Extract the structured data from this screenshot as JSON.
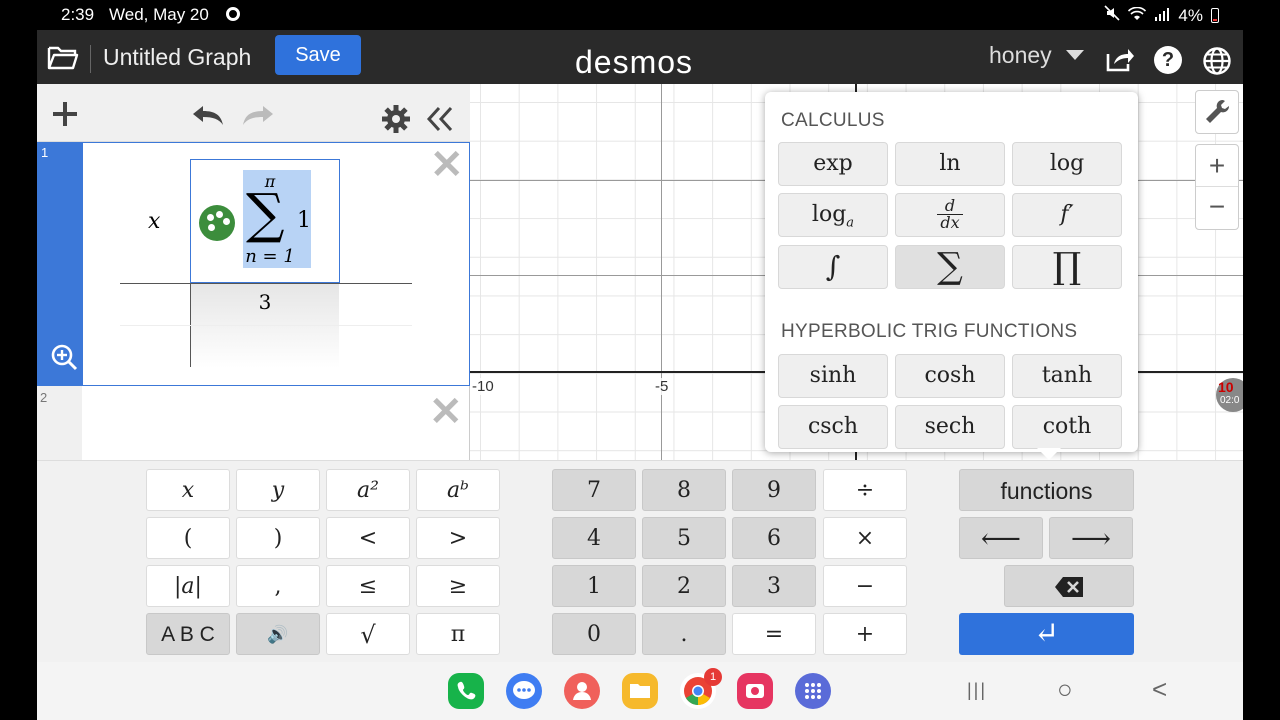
{
  "status_bar": {
    "time": "2:39",
    "date": "Wed, May 20",
    "battery": "4%"
  },
  "header": {
    "title": "Untitled Graph",
    "save_label": "Save",
    "logo": "desmos",
    "user": "honey"
  },
  "expressions": [
    {
      "index": "1",
      "table": {
        "header_x": "x",
        "sum_upper": "π",
        "sum_symbol": "∑",
        "sum_lower": "n = 1",
        "sum_body": "1",
        "value": "3"
      }
    },
    {
      "index": "2"
    }
  ],
  "graph": {
    "x_ticks": [
      "-10",
      "-5"
    ],
    "right_edge_label": "10",
    "timer": "02:0",
    "tools": {
      "zoom_in": "+",
      "zoom_out": "−"
    }
  },
  "functions_popover": {
    "sections": [
      {
        "title": "CALCULUS",
        "keys": [
          "exp",
          "ln",
          "log",
          "loga",
          "d/dx",
          "f′",
          "∫",
          "∑",
          "∏"
        ]
      },
      {
        "title": "HYPERBOLIC TRIG FUNCTIONS",
        "keys": [
          "sinh",
          "cosh",
          "tanh",
          "csch",
          "sech",
          "coth"
        ]
      }
    ],
    "log_base_main": "log",
    "log_base_sub": "a",
    "deriv_num": "d",
    "deriv_den": "dx"
  },
  "keypad": {
    "left": [
      "x",
      "y",
      "a²",
      "aᵇ",
      "(",
      ")",
      "<",
      ">",
      "|a|",
      ",",
      "≤",
      "≥",
      "A B C",
      "🔊",
      "√",
      "π"
    ],
    "numeric": [
      "7",
      "8",
      "9",
      "÷",
      "4",
      "5",
      "6",
      "×",
      "1",
      "2",
      "3",
      "−",
      "0",
      ".",
      "=",
      "+"
    ],
    "functions_label": "functions",
    "left_arrow": "⟵",
    "right_arrow": "⟶",
    "backspace": "⌫",
    "enter": "↵"
  },
  "nav": {
    "chrome_badge": "1",
    "recents": "|||",
    "home": "○",
    "back": "<"
  },
  "colors": {
    "accent": "#2f72dc",
    "expr_blue": "#3c78d8",
    "selection": "#b8d3f5",
    "palette_green": "#3c8d3c"
  }
}
